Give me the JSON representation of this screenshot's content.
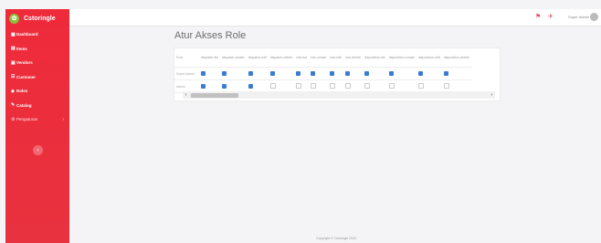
{
  "brand": {
    "name": "Cstoringle"
  },
  "sidebar": {
    "items": [
      {
        "label": "Dashboard",
        "icon": "dashboard-icon",
        "glyph": "▦"
      },
      {
        "label": "Items",
        "icon": "items-icon",
        "glyph": "▤"
      },
      {
        "label": "Vendors",
        "icon": "vendors-icon",
        "glyph": "▣"
      },
      {
        "label": "Customer",
        "icon": "customer-icon",
        "glyph": "☰"
      },
      {
        "label": "Roles",
        "icon": "roles-icon",
        "glyph": "◈"
      },
      {
        "label": "Catalog",
        "icon": "catalog-icon",
        "glyph": "✎"
      },
      {
        "label": "Pengaturan",
        "icon": "settings-icon",
        "glyph": "⚙"
      }
    ],
    "toggle_glyph": "‹"
  },
  "topbar": {
    "user_name": "Super Admin"
  },
  "page": {
    "title": "Atur Akses Role"
  },
  "table": {
    "role_header": "Role",
    "columns": [
      "dispatch-list",
      "dispatch-create",
      "dispatch-edit",
      "dispatch-delete",
      "role-list",
      "role-create",
      "role-edit",
      "role-delete",
      "disposition-list",
      "disposition-create",
      "disposition-edit",
      "disposition-delete"
    ],
    "rows": [
      {
        "role": "SuperAdmin",
        "perms": [
          true,
          true,
          true,
          true,
          true,
          true,
          true,
          true,
          true,
          true,
          true,
          true
        ]
      },
      {
        "role": "Admin",
        "perms": [
          true,
          true,
          true,
          false,
          false,
          false,
          false,
          false,
          false,
          false,
          false,
          false
        ]
      }
    ]
  },
  "scroll": {
    "left": "‹",
    "right": "›"
  },
  "footer": {
    "text": "Copyright © Cstoringle 2020"
  },
  "colors": {
    "sidebar": "#ef2a3a",
    "checked": "#3a7bd5",
    "flag": "#e84a5f"
  }
}
